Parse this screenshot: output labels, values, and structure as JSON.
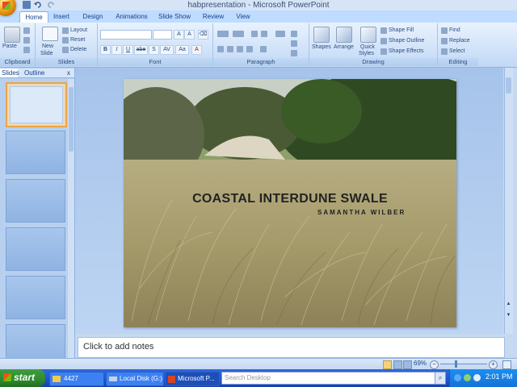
{
  "window": {
    "title": "habpresentation - Microsoft PowerPoint"
  },
  "ribbon": {
    "tabs": [
      "Home",
      "Insert",
      "Design",
      "Animations",
      "Slide Show",
      "Review",
      "View"
    ],
    "active_tab": "Home",
    "groups": {
      "clipboard": {
        "label": "Clipboard",
        "paste": "Paste"
      },
      "slides": {
        "label": "Slides",
        "new_slide": "New",
        "new_slide_2": "Slide",
        "layout": "Layout",
        "reset": "Reset",
        "delete": "Delete"
      },
      "font": {
        "label": "Font"
      },
      "paragraph": {
        "label": "Paragraph"
      },
      "drawing": {
        "label": "Drawing",
        "shapes": "Shapes",
        "arrange": "Arrange",
        "quick_styles": "Quick",
        "quick_styles_2": "Styles",
        "shape_fill": "Shape Fill",
        "shape_outline": "Shape Outline",
        "shape_effects": "Shape Effects"
      },
      "editing": {
        "label": "Editing",
        "find": "Find",
        "replace": "Replace",
        "select": "Select"
      }
    },
    "format_buttons": [
      "B",
      "I",
      "U",
      "abe",
      "S",
      "AV",
      "Aa",
      "A"
    ]
  },
  "left_pane": {
    "tabs": [
      "Slides",
      "Outline"
    ],
    "close": "x",
    "slide_count": 6
  },
  "slide": {
    "title": "COASTAL INTERDUNE SWALE",
    "subtitle": "SAMANTHA WILBER"
  },
  "notes": {
    "placeholder": "Click to add notes"
  },
  "statusbar": {
    "zoom": "69%"
  },
  "taskbar": {
    "start": "start",
    "tasks": [
      "4427",
      "Local Disk (G:)",
      "Microsoft P..."
    ],
    "search_placeholder": "Search Desktop",
    "clock": "2:01 PM"
  },
  "colors": {
    "ribbon_blue": "#bfdbff",
    "taskbar_blue": "#2157d7",
    "start_green": "#2e8a2e"
  }
}
